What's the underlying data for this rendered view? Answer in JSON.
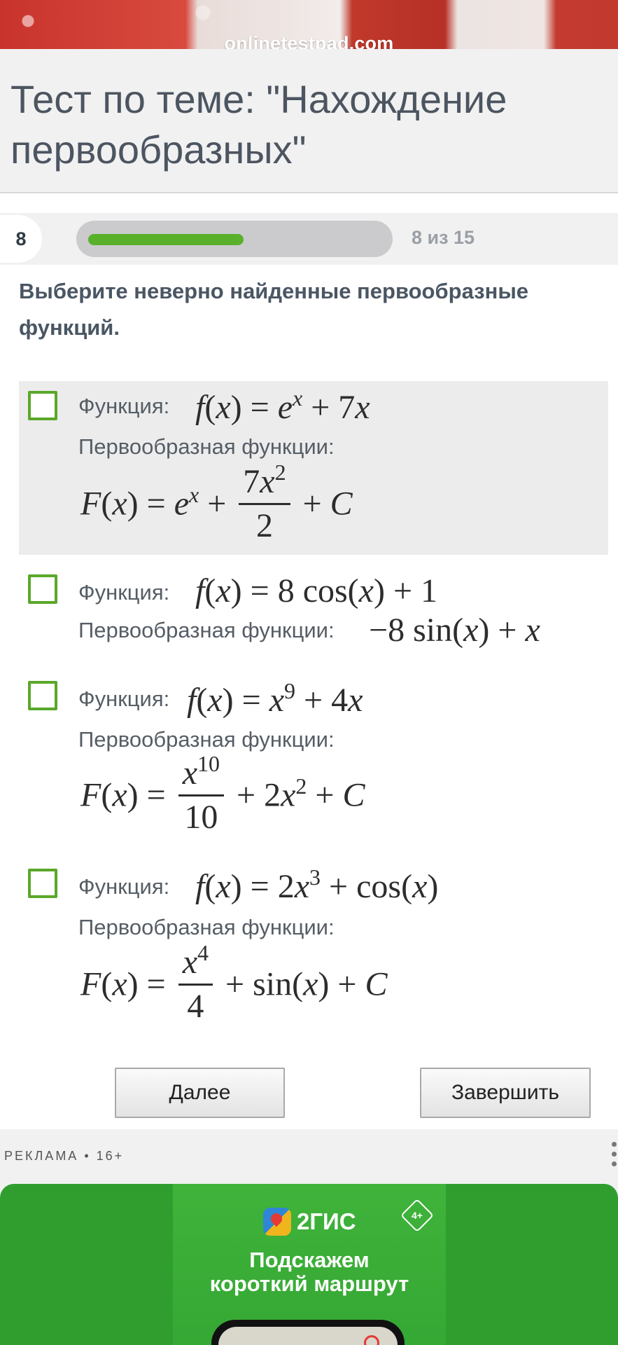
{
  "header": {
    "domain": "onlinetestpad.com",
    "title": "Тест по теме: \"Нахождение первообразных\""
  },
  "progress": {
    "current": "8",
    "counter": "8 из 15",
    "fraction": 0.53,
    "color": "#59b12b"
  },
  "question": {
    "prompt": "Выберите неверно найденные первообразные функций.",
    "function_label": "Функция:",
    "antiderivative_label": "Первообразная функции:",
    "options": [
      {
        "function": "f(x) = e^x + 7x",
        "antiderivative": "F(x) = e^x + 7x^2/2 + C",
        "checked": false,
        "highlighted": true
      },
      {
        "function": "f(x) = 8cos(x) + 1",
        "antiderivative": "−8sin(x) + x",
        "checked": false,
        "highlighted": false
      },
      {
        "function": "f(x) = x^9 + 4x",
        "antiderivative": "F(x) = x^10/10 + 2x^2 + C",
        "checked": false,
        "highlighted": false
      },
      {
        "function": "f(x) = 2x^3 + cos(x)",
        "antiderivative": "F(x) = x^4/4 + sin(x) + C",
        "checked": false,
        "highlighted": false
      }
    ]
  },
  "buttons": {
    "next": "Далее",
    "finish": "Завершить"
  },
  "ad": {
    "label": "РЕКЛАМА • 16+",
    "brand": "2ГИС",
    "age": "4+",
    "slogan_line1": "Подскажем",
    "slogan_line2": "короткий маршрут",
    "background_color": "#2f9e2f"
  },
  "colors": {
    "checkbox_border": "#5aa82a",
    "title_text": "#4c5560"
  },
  "icons": {
    "ad_menu": "more-vertical-icon",
    "brand_logo": "2gis-logo-icon"
  }
}
